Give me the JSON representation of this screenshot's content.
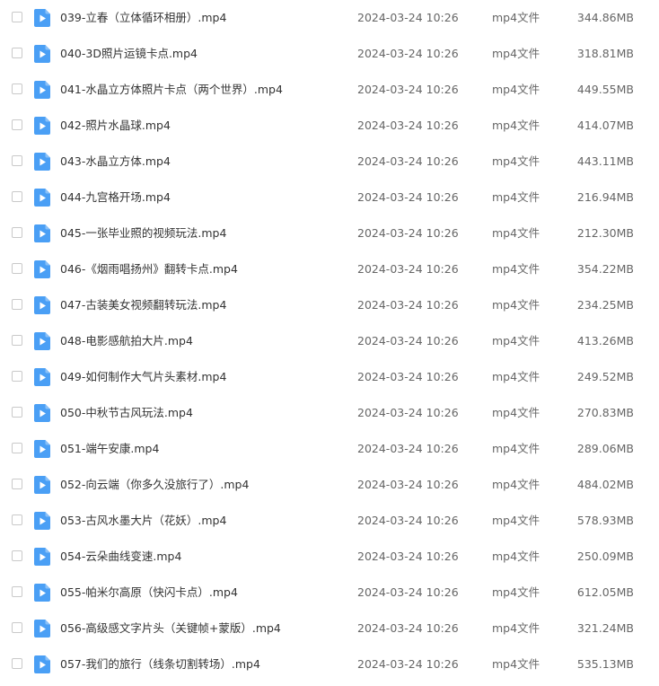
{
  "theme": {
    "icon_color": "#4a9ff5",
    "checkbox_border": "#c9c9c9"
  },
  "files": [
    {
      "name": "039-立春（立体循环相册）.mp4",
      "date": "2024-03-24 10:26",
      "type": "mp4文件",
      "size": "344.86MB",
      "icon": "video-file-icon"
    },
    {
      "name": "040-3D照片运镜卡点.mp4",
      "date": "2024-03-24 10:26",
      "type": "mp4文件",
      "size": "318.81MB",
      "icon": "video-file-icon"
    },
    {
      "name": "041-水晶立方体照片卡点（两个世界）.mp4",
      "date": "2024-03-24 10:26",
      "type": "mp4文件",
      "size": "449.55MB",
      "icon": "video-file-icon"
    },
    {
      "name": "042-照片水晶球.mp4",
      "date": "2024-03-24 10:26",
      "type": "mp4文件",
      "size": "414.07MB",
      "icon": "video-file-icon"
    },
    {
      "name": "043-水晶立方体.mp4",
      "date": "2024-03-24 10:26",
      "type": "mp4文件",
      "size": "443.11MB",
      "icon": "video-file-icon"
    },
    {
      "name": "044-九宫格开场.mp4",
      "date": "2024-03-24 10:26",
      "type": "mp4文件",
      "size": "216.94MB",
      "icon": "video-file-icon"
    },
    {
      "name": "045-一张毕业照的视频玩法.mp4",
      "date": "2024-03-24 10:26",
      "type": "mp4文件",
      "size": "212.30MB",
      "icon": "video-file-icon"
    },
    {
      "name": "046-《烟雨唱扬州》翻转卡点.mp4",
      "date": "2024-03-24 10:26",
      "type": "mp4文件",
      "size": "354.22MB",
      "icon": "video-file-icon"
    },
    {
      "name": "047-古装美女视频翻转玩法.mp4",
      "date": "2024-03-24 10:26",
      "type": "mp4文件",
      "size": "234.25MB",
      "icon": "video-file-icon"
    },
    {
      "name": "048-电影感航拍大片.mp4",
      "date": "2024-03-24 10:26",
      "type": "mp4文件",
      "size": "413.26MB",
      "icon": "video-file-icon"
    },
    {
      "name": "049-如何制作大气片头素材.mp4",
      "date": "2024-03-24 10:26",
      "type": "mp4文件",
      "size": "249.52MB",
      "icon": "video-file-icon"
    },
    {
      "name": "050-中秋节古风玩法.mp4",
      "date": "2024-03-24 10:26",
      "type": "mp4文件",
      "size": "270.83MB",
      "icon": "video-file-icon"
    },
    {
      "name": "051-端午安康.mp4",
      "date": "2024-03-24 10:26",
      "type": "mp4文件",
      "size": "289.06MB",
      "icon": "video-file-icon"
    },
    {
      "name": "052-向云端（你多久没旅行了）.mp4",
      "date": "2024-03-24 10:26",
      "type": "mp4文件",
      "size": "484.02MB",
      "icon": "video-file-icon"
    },
    {
      "name": "053-古风水墨大片（花妖）.mp4",
      "date": "2024-03-24 10:26",
      "type": "mp4文件",
      "size": "578.93MB",
      "icon": "video-file-icon"
    },
    {
      "name": "054-云朵曲线变速.mp4",
      "date": "2024-03-24 10:26",
      "type": "mp4文件",
      "size": "250.09MB",
      "icon": "video-file-icon"
    },
    {
      "name": "055-帕米尔高原（快闪卡点）.mp4",
      "date": "2024-03-24 10:26",
      "type": "mp4文件",
      "size": "612.05MB",
      "icon": "video-file-icon"
    },
    {
      "name": "056-高级感文字片头（关键帧+蒙版）.mp4",
      "date": "2024-03-24 10:26",
      "type": "mp4文件",
      "size": "321.24MB",
      "icon": "video-file-icon"
    },
    {
      "name": "057-我们的旅行（线条切割转场）.mp4",
      "date": "2024-03-24 10:26",
      "type": "mp4文件",
      "size": "535.13MB",
      "icon": "video-file-icon"
    }
  ]
}
